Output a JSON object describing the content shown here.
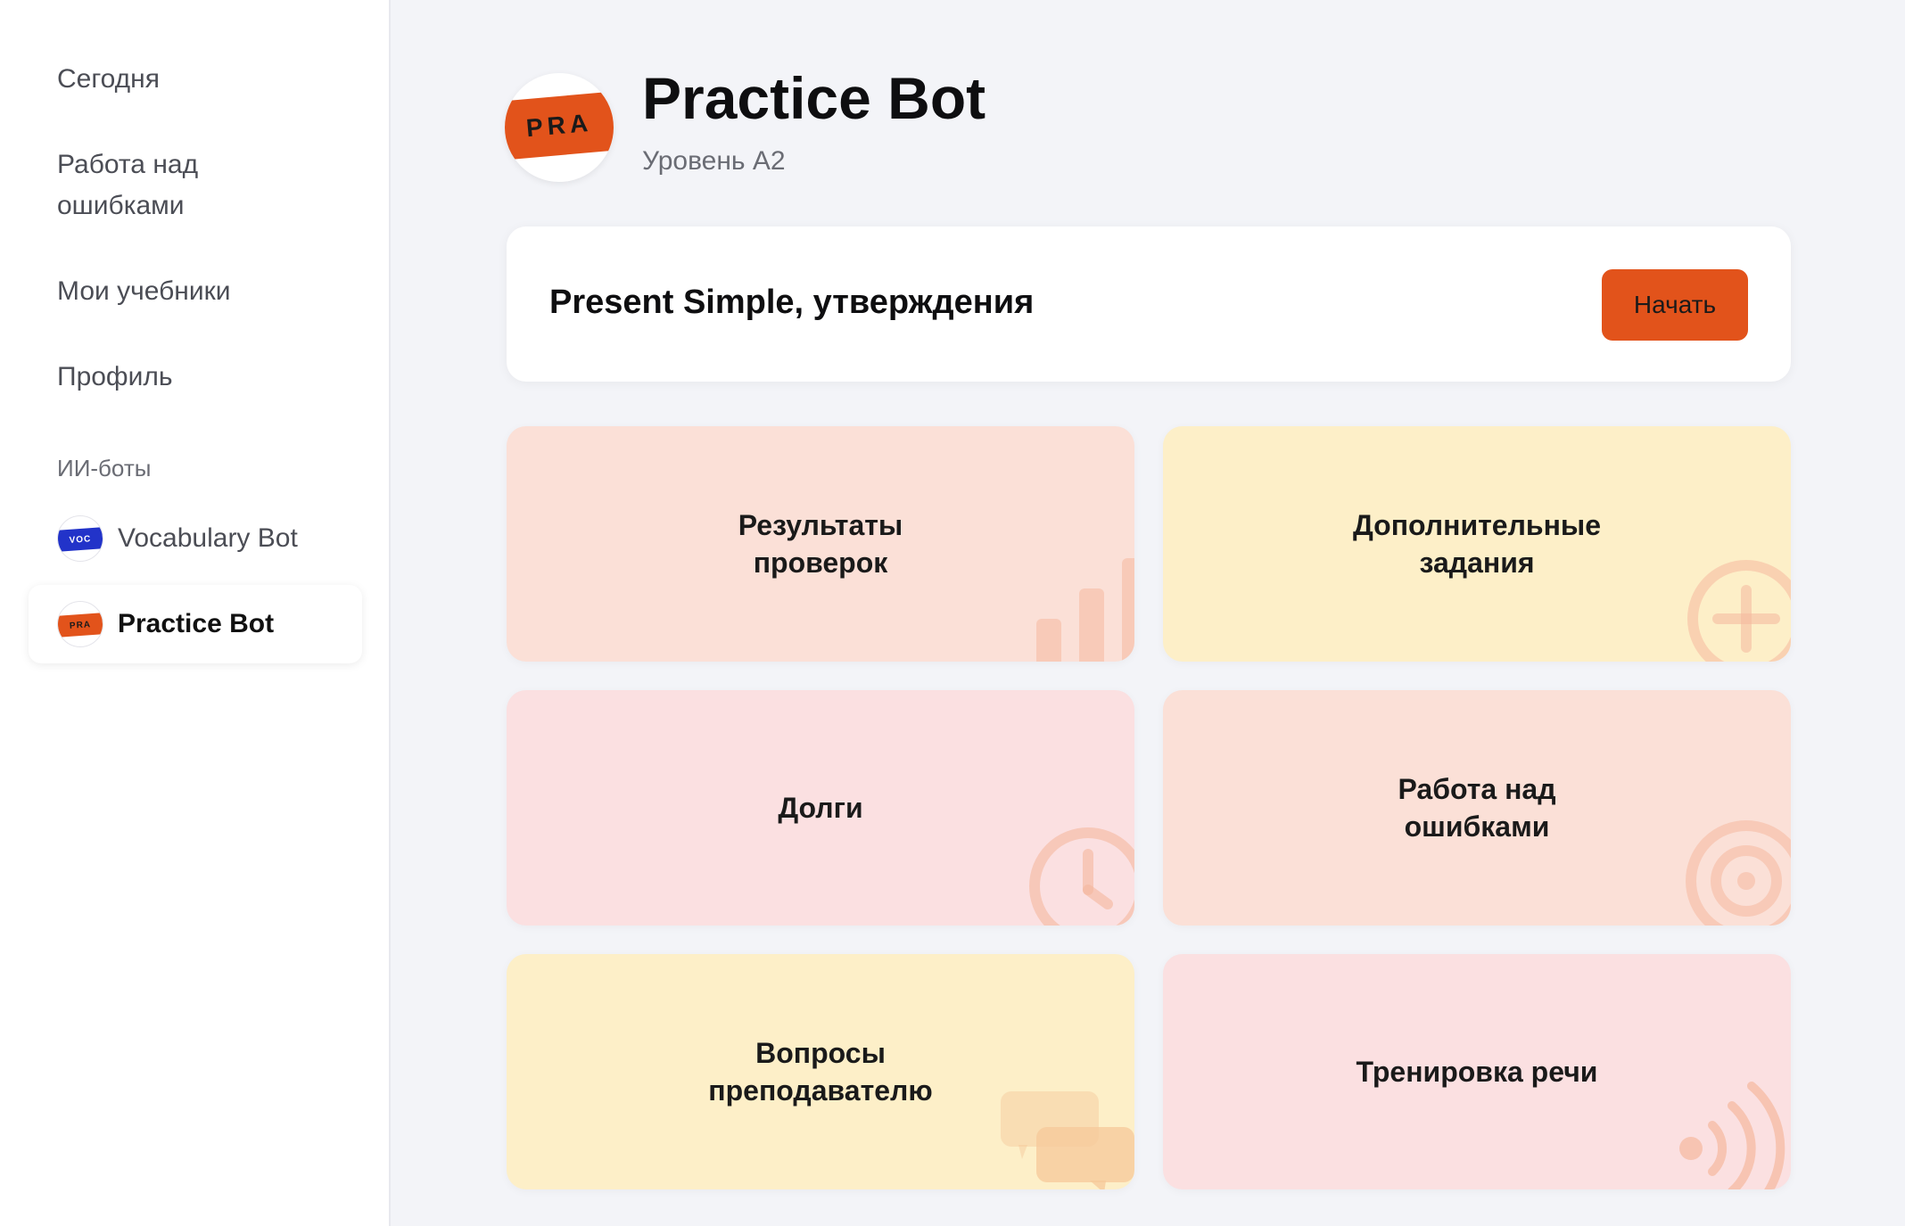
{
  "sidebar": {
    "nav": [
      {
        "label": "Сегодня"
      },
      {
        "label": "Работа над ошибками"
      },
      {
        "label": "Мои учебники"
      },
      {
        "label": "Профиль"
      }
    ],
    "section_label": "ИИ-боты",
    "bots": [
      {
        "label": "Vocabulary Bot",
        "badge": "VOC",
        "badge_color": "#2233c9"
      },
      {
        "label": "Practice Bot",
        "badge": "PRA",
        "badge_color": "#e2531b",
        "active": true
      }
    ]
  },
  "header": {
    "logo_text": "PRA",
    "title": "Practice Bot",
    "subtitle": "Уровень А2"
  },
  "lesson": {
    "title": "Present Simple, утверждения",
    "start_label": "Начать"
  },
  "tiles": [
    {
      "label": "Результаты\nпроверок",
      "icon": "bar-chart-icon",
      "color": "#fbe0d7"
    },
    {
      "label": "Дополнительные\nзадания",
      "icon": "plus-circle-icon",
      "color": "#fdefc8"
    },
    {
      "label": "Долги",
      "icon": "clock-icon",
      "color": "#fbe0e1"
    },
    {
      "label": "Работа над\nошибками",
      "icon": "target-icon",
      "color": "#fbe0d7"
    },
    {
      "label": "Вопросы\nпреподавателю",
      "icon": "chat-bubbles-icon",
      "color": "#fdefc8"
    },
    {
      "label": "Тренировка речи",
      "icon": "sound-waves-icon",
      "color": "#fbe0e1"
    }
  ],
  "colors": {
    "accent": "#e2531b",
    "background": "#f3f4f8",
    "icon_tint": "#f5b89e"
  }
}
